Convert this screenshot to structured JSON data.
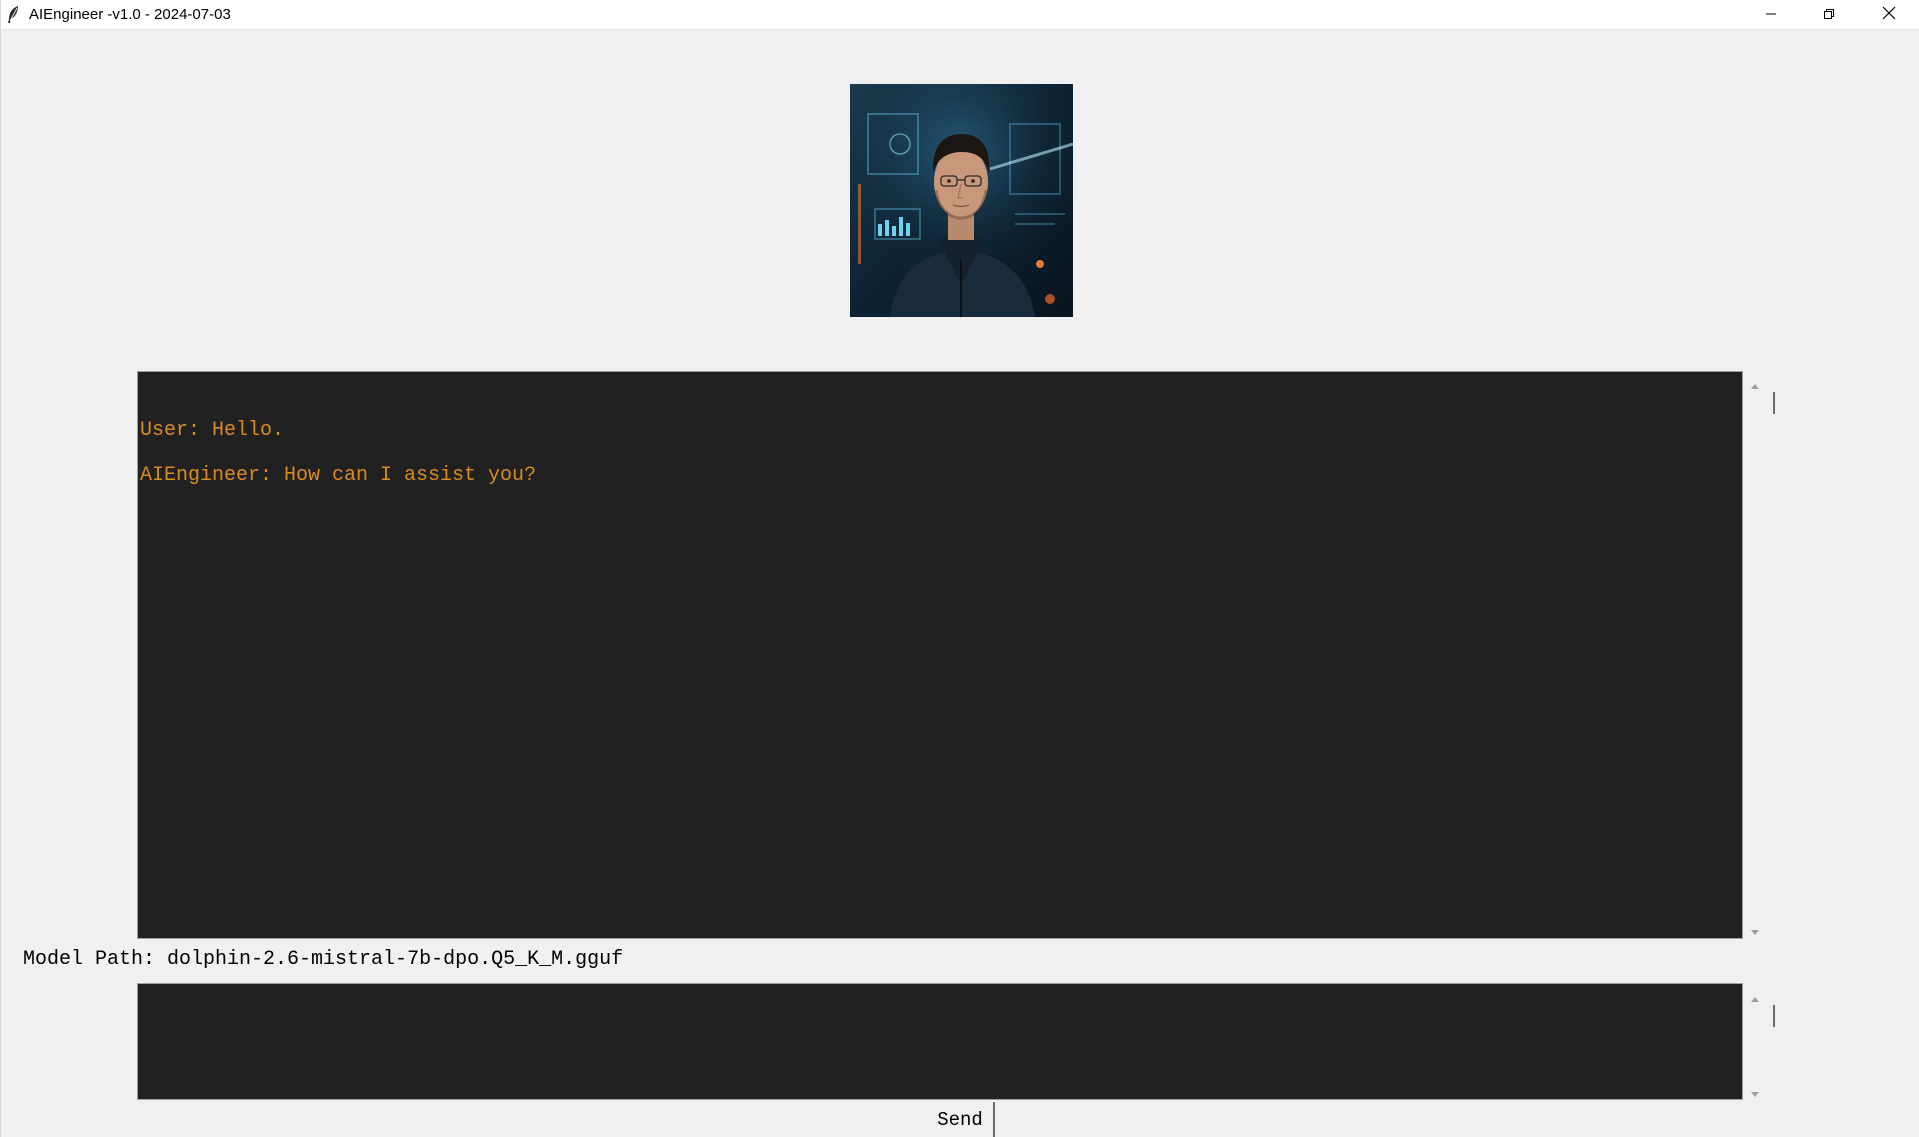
{
  "window": {
    "title": "AIEngineer -v1.0 - 2024-07-03",
    "icon": "feather-icon",
    "controls": {
      "minimize_icon": "minimize-icon",
      "restore_icon": "restore-icon",
      "close_icon": "close-icon"
    }
  },
  "avatar": {
    "icon": "ai-engineer-portrait"
  },
  "chat": {
    "messages": [
      "User: Hello.",
      "AIEngineer: How can I assist you?"
    ],
    "text_color": "#d98c1f",
    "background": "#212121"
  },
  "model": {
    "label_text": "Model Path: dolphin-2.6-mistral-7b-dpo.Q5_K_M.gguf"
  },
  "input": {
    "value": ""
  },
  "send": {
    "label": "Send"
  }
}
